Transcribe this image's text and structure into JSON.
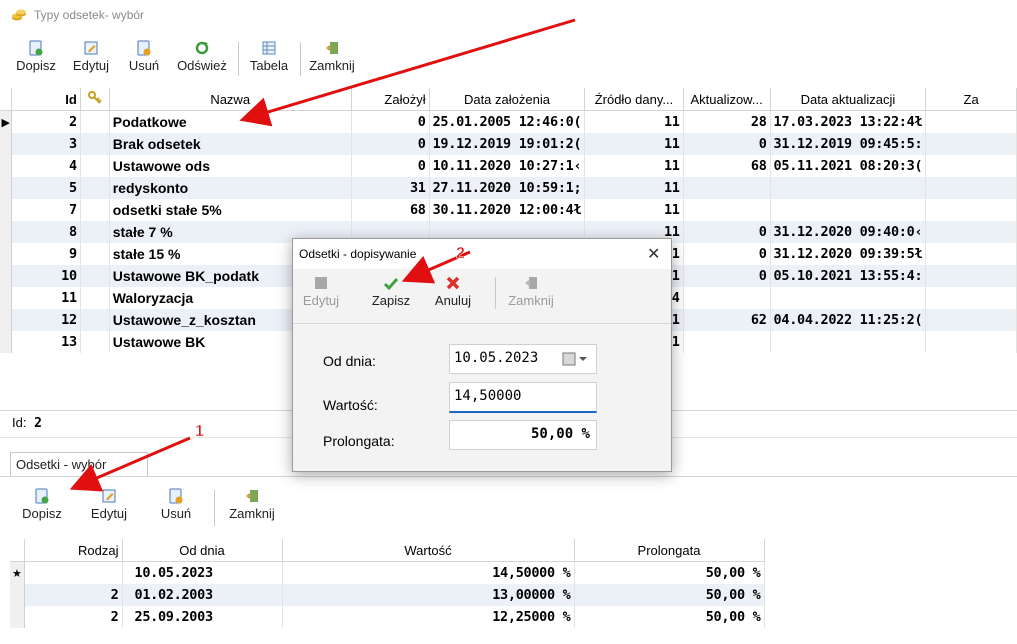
{
  "window": {
    "title": "Typy odsetek- wybór"
  },
  "toolbar_top": {
    "dopisz": "Dopisz",
    "edytuj": "Edytuj",
    "usun": "Usuń",
    "odswiez": "Odśwież",
    "tabela": "Tabela",
    "zamknij": "Zamknij"
  },
  "top_grid": {
    "headers": [
      "Id",
      "Nazwa",
      "Założył",
      "Data założenia",
      "Źródło dany...",
      "Aktualizow...",
      "Data aktualizacji",
      "Za"
    ],
    "rows": [
      {
        "id": "2",
        "nazwa": "Podatkowe",
        "zal": "0",
        "data": "25.01.2005 12:46:0(",
        "zrodlo": "11",
        "akt": "28",
        "data_akt": "17.03.2023 13:22:4ł",
        "indicator": "▶"
      },
      {
        "id": "3",
        "nazwa": "Brak odsetek",
        "zal": "0",
        "data": "19.12.2019 19:01:2(",
        "zrodlo": "11",
        "akt": "0",
        "data_akt": "31.12.2019 09:45:5:",
        "indicator": ""
      },
      {
        "id": "4",
        "nazwa": "Ustawowe ods",
        "zal": "0",
        "data": "10.11.2020 10:27:1‹",
        "zrodlo": "11",
        "akt": "68",
        "data_akt": "05.11.2021 08:20:3(",
        "indicator": ""
      },
      {
        "id": "5",
        "nazwa": "redyskonto",
        "zal": "31",
        "data": "27.11.2020 10:59:1;",
        "zrodlo": "11",
        "akt": "",
        "data_akt": "",
        "indicator": ""
      },
      {
        "id": "7",
        "nazwa": "odsetki stałe 5%",
        "zal": "68",
        "data": "30.11.2020 12:00:4ł",
        "zrodlo": "11",
        "akt": "",
        "data_akt": "",
        "indicator": ""
      },
      {
        "id": "8",
        "nazwa": "stałe 7 %",
        "zal": "",
        "data": "",
        "zrodlo": "11",
        "akt": "0",
        "data_akt": "31.12.2020 09:40:0‹",
        "indicator": ""
      },
      {
        "id": "9",
        "nazwa": "stałe 15 %",
        "zal": "",
        "data": "",
        "zrodlo": "11",
        "akt": "0",
        "data_akt": "31.12.2020 09:39:5ł",
        "indicator": ""
      },
      {
        "id": "10",
        "nazwa": "Ustawowe BK_podatk",
        "zal": "",
        "data": "",
        "zrodlo": "11",
        "akt": "0",
        "data_akt": "05.10.2021 13:55:4:",
        "indicator": ""
      },
      {
        "id": "11",
        "nazwa": "Waloryzacja",
        "zal": "",
        "data": "",
        "zrodlo": "14",
        "akt": "",
        "data_akt": "",
        "indicator": ""
      },
      {
        "id": "12",
        "nazwa": "Ustawowe_z_kosztan",
        "zal": "",
        "data": "",
        "zrodlo": "11",
        "akt": "62",
        "data_akt": "04.04.2022 11:25:2(",
        "indicator": ""
      },
      {
        "id": "13",
        "nazwa": "Ustawowe BK",
        "zal": "",
        "data": "",
        "zrodlo": "11",
        "akt": "",
        "data_akt": "",
        "indicator": ""
      }
    ]
  },
  "id_bar": {
    "label": "Id:",
    "value": "2"
  },
  "tab": {
    "label": "Odsetki - wybór"
  },
  "toolbar_bottom": {
    "dopisz": "Dopisz",
    "edytuj": "Edytuj",
    "usun": "Usuń",
    "zamknij": "Zamknij"
  },
  "bottom_grid": {
    "headers": [
      "Rodzaj",
      "Od dnia",
      "Wartość",
      "Prolongata"
    ],
    "rows": [
      {
        "indicator": "★",
        "rodzaj": "",
        "od": "10.05.2023",
        "wartosc": "14,50000 %",
        "prol": "50,00 %"
      },
      {
        "indicator": "",
        "rodzaj": "2",
        "od": "01.02.2003",
        "wartosc": "13,00000 %",
        "prol": "50,00 %"
      },
      {
        "indicator": "",
        "rodzaj": "2",
        "od": "25.09.2003",
        "wartosc": "12,25000 %",
        "prol": "50,00 %"
      }
    ]
  },
  "dialog": {
    "title": "Odsetki - dopisywanie",
    "close": "✕",
    "buttons": {
      "edytuj": "Edytuj",
      "zapisz": "Zapisz",
      "anuluj": "Anuluj",
      "zamknij": "Zamknij"
    },
    "fields": {
      "od_dnia_label": "Od dnia:",
      "od_dnia_value": "10.05.2023",
      "wartosc_label": "Wartość:",
      "wartosc_value": "14,50000",
      "prolongata_label": "Prolongata:",
      "prolongata_value": "50,00 %"
    }
  },
  "annotations": {
    "marker1": "1",
    "marker2": "2"
  },
  "colors": {
    "arrow": "#e01010",
    "row_alt": "#ecf1f8",
    "accent_save": "#3fa23f",
    "cancel": "#d9302c"
  }
}
